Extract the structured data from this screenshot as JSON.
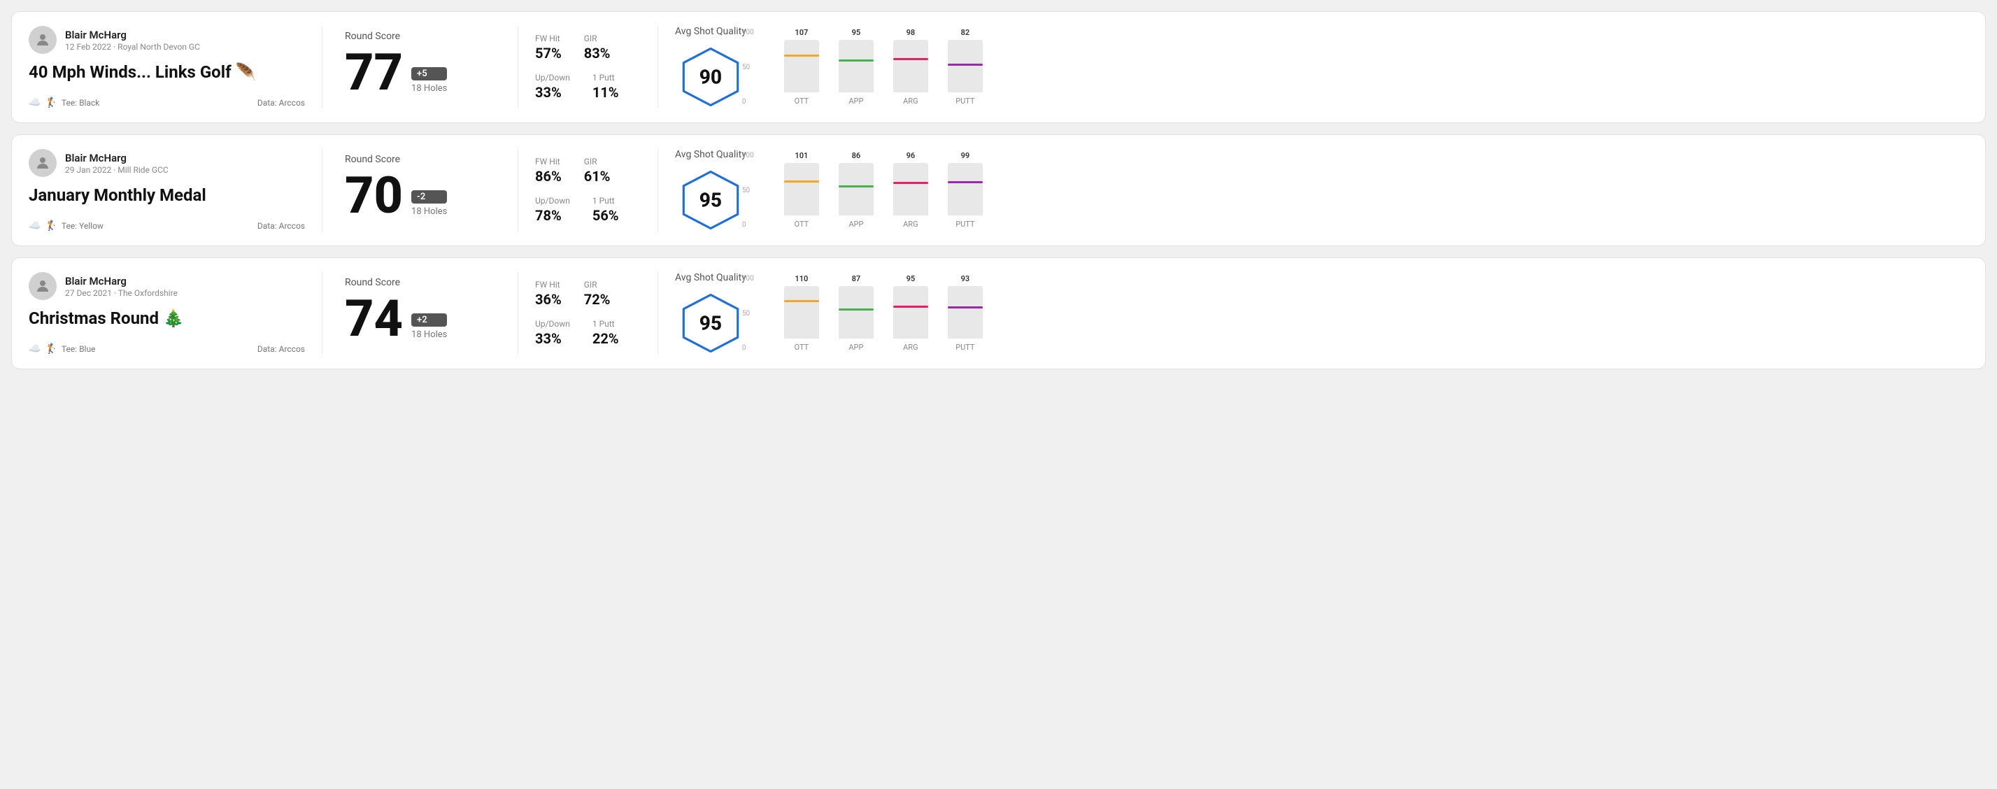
{
  "rounds": [
    {
      "id": "round1",
      "user": {
        "name": "Blair McHarg",
        "date": "12 Feb 2022 · Royal North Devon GC"
      },
      "title": "40 Mph Winds... Links Golf 🪶",
      "tee": "Black",
      "data_source": "Data: Arccos",
      "score": {
        "label": "Round Score",
        "number": "77",
        "badge": "+5",
        "badge_type": "pos",
        "holes": "18 Holes"
      },
      "stats": {
        "fw_hit_label": "FW Hit",
        "fw_hit_value": "57%",
        "gir_label": "GIR",
        "gir_value": "83%",
        "updown_label": "Up/Down",
        "updown_value": "33%",
        "oneputt_label": "1 Putt",
        "oneputt_value": "11%"
      },
      "shot_quality": {
        "label": "Avg Shot Quality",
        "score": "90",
        "bars": [
          {
            "label": "OTT",
            "value": 107,
            "color": "#f5a623",
            "height_pct": 72
          },
          {
            "label": "APP",
            "value": 95,
            "color": "#4caf50",
            "height_pct": 63
          },
          {
            "label": "ARG",
            "value": 98,
            "color": "#e91e63",
            "height_pct": 65
          },
          {
            "label": "PUTT",
            "value": 82,
            "color": "#9c27b0",
            "height_pct": 55
          }
        ]
      }
    },
    {
      "id": "round2",
      "user": {
        "name": "Blair McHarg",
        "date": "29 Jan 2022 · Mill Ride GCC"
      },
      "title": "January Monthly Medal",
      "tee": "Yellow",
      "data_source": "Data: Arccos",
      "score": {
        "label": "Round Score",
        "number": "70",
        "badge": "-2",
        "badge_type": "neg",
        "holes": "18 Holes"
      },
      "stats": {
        "fw_hit_label": "FW Hit",
        "fw_hit_value": "86%",
        "gir_label": "GIR",
        "gir_value": "61%",
        "updown_label": "Up/Down",
        "updown_value": "78%",
        "oneputt_label": "1 Putt",
        "oneputt_value": "56%"
      },
      "shot_quality": {
        "label": "Avg Shot Quality",
        "score": "95",
        "bars": [
          {
            "label": "OTT",
            "value": 101,
            "color": "#f5a623",
            "height_pct": 67
          },
          {
            "label": "APP",
            "value": 86,
            "color": "#4caf50",
            "height_pct": 57
          },
          {
            "label": "ARG",
            "value": 96,
            "color": "#e91e63",
            "height_pct": 64
          },
          {
            "label": "PUTT",
            "value": 99,
            "color": "#9c27b0",
            "height_pct": 66
          }
        ]
      }
    },
    {
      "id": "round3",
      "user": {
        "name": "Blair McHarg",
        "date": "27 Dec 2021 · The Oxfordshire"
      },
      "title": "Christmas Round 🎄",
      "tee": "Blue",
      "data_source": "Data: Arccos",
      "score": {
        "label": "Round Score",
        "number": "74",
        "badge": "+2",
        "badge_type": "pos",
        "holes": "18 Holes"
      },
      "stats": {
        "fw_hit_label": "FW Hit",
        "fw_hit_value": "36%",
        "gir_label": "GIR",
        "gir_value": "72%",
        "updown_label": "Up/Down",
        "updown_value": "33%",
        "oneputt_label": "1 Putt",
        "oneputt_value": "22%"
      },
      "shot_quality": {
        "label": "Avg Shot Quality",
        "score": "95",
        "bars": [
          {
            "label": "OTT",
            "value": 110,
            "color": "#f5a623",
            "height_pct": 73
          },
          {
            "label": "APP",
            "value": 87,
            "color": "#4caf50",
            "height_pct": 58
          },
          {
            "label": "ARG",
            "value": 95,
            "color": "#e91e63",
            "height_pct": 63
          },
          {
            "label": "PUTT",
            "value": 93,
            "color": "#9c27b0",
            "height_pct": 62
          }
        ]
      }
    }
  ],
  "y_axis": {
    "top": "100",
    "mid": "50",
    "bot": "0"
  }
}
